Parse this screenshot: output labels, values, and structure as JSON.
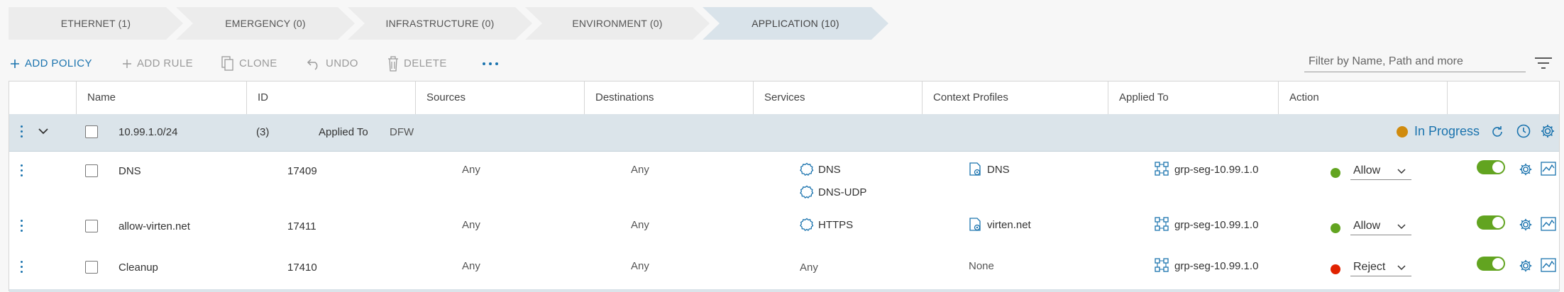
{
  "tabs": [
    {
      "label": "ETHERNET (1)"
    },
    {
      "label": "EMERGENCY (0)"
    },
    {
      "label": "INFRASTRUCTURE (0)"
    },
    {
      "label": "ENVIRONMENT (0)"
    },
    {
      "label": "APPLICATION (10)",
      "active": true
    }
  ],
  "toolbar": {
    "add_policy": "ADD POLICY",
    "add_rule": "ADD RULE",
    "clone": "CLONE",
    "undo": "UNDO",
    "delete": "DELETE",
    "more_icon": "ellipsis-horizontal-icon"
  },
  "filter": {
    "placeholder": "Filter by Name, Path and more",
    "icon": "filter-icon"
  },
  "columns": [
    "Name",
    "ID",
    "Sources",
    "Destinations",
    "Services",
    "Context Profiles",
    "Applied To",
    "Action"
  ],
  "policy": {
    "name": "10.99.1.0/24",
    "count": "(3)",
    "applied_to_label": "Applied To",
    "applied_to_value": "DFW",
    "status": "In Progress",
    "status_color": "#d08b0e"
  },
  "rules": [
    {
      "name": "DNS",
      "id": "17409",
      "sources": "Any",
      "destinations": "Any",
      "services": [
        "DNS",
        "DNS-UDP"
      ],
      "context_profile": "DNS",
      "applied_to": "grp-seg-10.99.1.0",
      "action": "Allow",
      "action_color": "#62a420"
    },
    {
      "name": "allow-virten.net",
      "id": "17411",
      "sources": "Any",
      "destinations": "Any",
      "services": [
        "HTTPS"
      ],
      "context_profile": "virten.net",
      "applied_to": "grp-seg-10.99.1.0",
      "action": "Allow",
      "action_color": "#62a420"
    },
    {
      "name": "Cleanup",
      "id": "17410",
      "sources": "Any",
      "destinations": "Any",
      "services_text": "Any",
      "context_profile_text": "None",
      "applied_to": "grp-seg-10.99.1.0",
      "action": "Reject",
      "action_color": "#e12200"
    }
  ],
  "colors": {
    "accent": "#1a73ae",
    "toggle_on": "#62a420",
    "policy_bg": "#dbe4ea"
  }
}
